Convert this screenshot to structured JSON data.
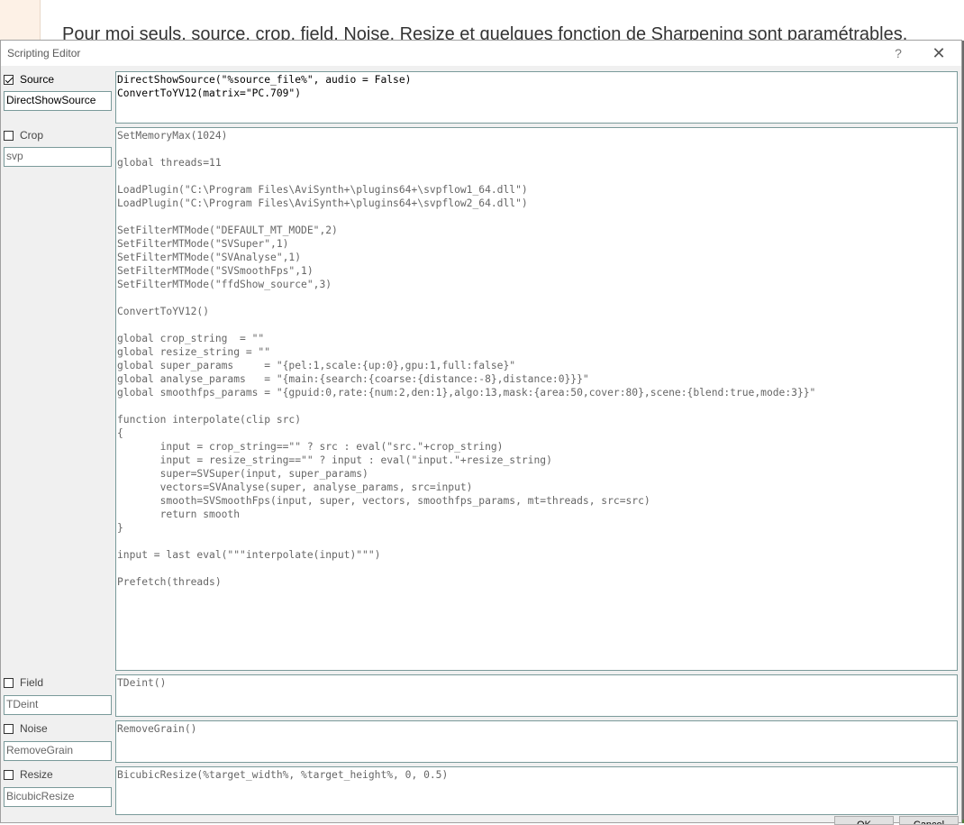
{
  "background": {
    "text": "Pour moi seuls, source, crop, field, Noise, Resize et quelques fonction de Sharpening sont paramétrables."
  },
  "dialog": {
    "title": "Scripting Editor",
    "help_glyph": "?",
    "close_glyph": "✕"
  },
  "sections": {
    "source": {
      "label": "Source",
      "checked": true,
      "name": "DirectShowSource",
      "code": "DirectShowSource(\"%source_file%\", audio = False)\nConvertToYV12(matrix=\"PC.709\")"
    },
    "crop": {
      "label": "Crop",
      "checked": false,
      "name": "svp",
      "code": "SetMemoryMax(1024)\n\nglobal threads=11\n\nLoadPlugin(\"C:\\Program Files\\AviSynth+\\plugins64+\\svpflow1_64.dll\")\nLoadPlugin(\"C:\\Program Files\\AviSynth+\\plugins64+\\svpflow2_64.dll\")\n\nSetFilterMTMode(\"DEFAULT_MT_MODE\",2)\nSetFilterMTMode(\"SVSuper\",1)\nSetFilterMTMode(\"SVAnalyse\",1)\nSetFilterMTMode(\"SVSmoothFps\",1)\nSetFilterMTMode(\"ffdShow_source\",3)\n\nConvertToYV12()\n\nglobal crop_string  = \"\"\nglobal resize_string = \"\"\nglobal super_params     = \"{pel:1,scale:{up:0},gpu:1,full:false}\"\nglobal analyse_params   = \"{main:{search:{coarse:{distance:-8},distance:0}}}\"\nglobal smoothfps_params = \"{gpuid:0,rate:{num:2,den:1},algo:13,mask:{area:50,cover:80},scene:{blend:true,mode:3}}\"\n\nfunction interpolate(clip src)\n{\n       input = crop_string==\"\" ? src : eval(\"src.\"+crop_string)\n       input = resize_string==\"\" ? input : eval(\"input.\"+resize_string)\n       super=SVSuper(input, super_params)\n       vectors=SVAnalyse(super, analyse_params, src=input)\n       smooth=SVSmoothFps(input, super, vectors, smoothfps_params, mt=threads, src=src)\n       return smooth\n}\n\ninput = last eval(\"\"\"interpolate(input)\"\"\")\n\nPrefetch(threads)"
    },
    "field": {
      "label": "Field",
      "checked": false,
      "name": "TDeint",
      "code": "TDeint()"
    },
    "noise": {
      "label": "Noise",
      "checked": false,
      "name": "RemoveGrain",
      "code": "RemoveGrain()"
    },
    "resize": {
      "label": "Resize",
      "checked": false,
      "name": "BicubicResize",
      "code": "BicubicResize(%target_width%, %target_height%, 0, 0.5)"
    }
  },
  "buttons": {
    "ok_label": "OK",
    "cancel_label": "Cancel"
  }
}
